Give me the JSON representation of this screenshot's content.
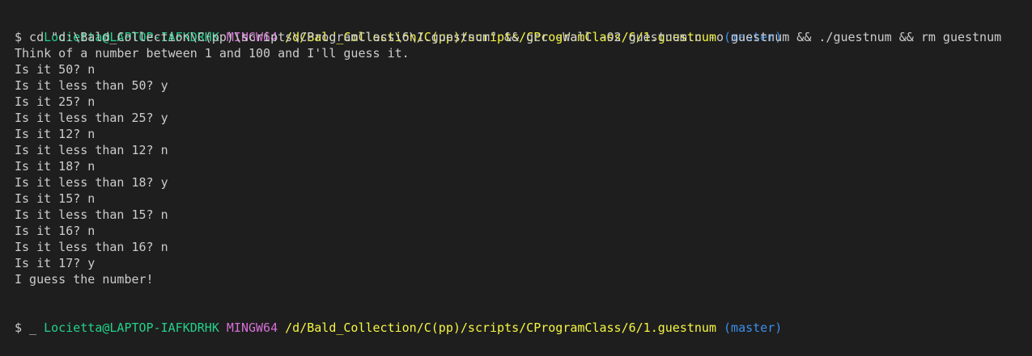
{
  "prompt1": {
    "user_host": "Locietta@LAPTOP-IAFKDRHK",
    "system": "MINGW64",
    "path": "/d/Bald_Collection/C(pp)/scripts/CProgramClass/6/1.guestnum",
    "branch": "(master)"
  },
  "command_line": "$ cd \"d:\\Bald_Collection\\C(pp)\\scripts\\CProgramClass\\6\\1.guestnum\" && gcc -Wall -O2 guestnum.c -o guestnum && ./guestnum && rm guestnum",
  "output_lines": [
    "Think of a number between 1 and 100 and I'll guess it.",
    "Is it 50? n",
    "Is it less than 50? y",
    "Is it 25? n",
    "Is it less than 25? y",
    "Is it 12? n",
    "Is it less than 12? n",
    "Is it 18? n",
    "Is it less than 18? y",
    "Is it 15? n",
    "Is it less than 15? n",
    "Is it 16? n",
    "Is it less than 16? n",
    "Is it 17? y",
    "I guess the number!"
  ],
  "prompt2": {
    "user_host": "Locietta@LAPTOP-IAFKDRHK",
    "system": "MINGW64",
    "path": "/d/Bald_Collection/C(pp)/scripts/CProgramClass/6/1.guestnum",
    "branch": "(master)"
  },
  "input_line": "$ _",
  "colors": {
    "background": "#1e1e1e",
    "text": "#cccccc",
    "user_host": "#23d18b",
    "system": "#d670d6",
    "path": "#f5f543",
    "branch": "#3b8eea"
  }
}
